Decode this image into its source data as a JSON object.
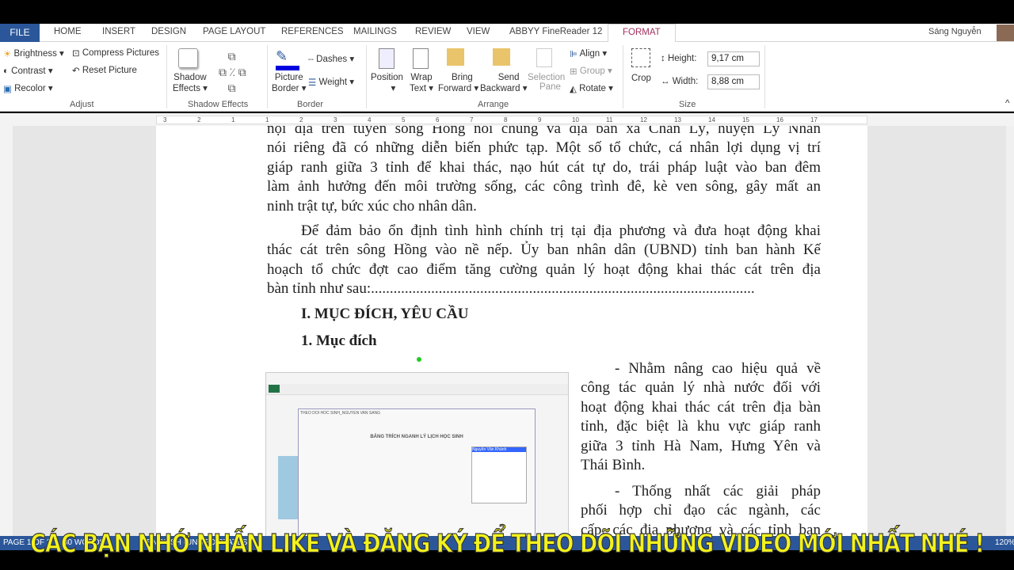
{
  "tabs": {
    "file": "FILE",
    "items": [
      "HOME",
      "INSERT",
      "DESIGN",
      "PAGE LAYOUT",
      "REFERENCES",
      "MAILINGS",
      "REVIEW",
      "VIEW",
      "ABBYY FineReader 12"
    ],
    "format": "FORMAT",
    "user": "Sáng Nguyễn"
  },
  "ribbon": {
    "adjust": {
      "brightness": "Brightness",
      "contrast": "Contrast",
      "recolor": "Recolor",
      "compress": "Compress Pictures",
      "reset": "Reset Picture",
      "label": "Adjust"
    },
    "shadow": {
      "button1": "Shadow",
      "button2": "Effects",
      "label": "Shadow Effects"
    },
    "border": {
      "picture1": "Picture",
      "picture2": "Border",
      "dashes": "Dashes",
      "weight": "Weight",
      "label": "Border"
    },
    "arrange": {
      "position": "Position",
      "wrap1": "Wrap",
      "wrap2": "Text",
      "bring1": "Bring",
      "bring2": "Forward",
      "send1": "Send",
      "send2": "Backward",
      "sel1": "Selection",
      "sel2": "Pane",
      "align": "Align",
      "group": "Group",
      "rotate": "Rotate",
      "label": "Arrange"
    },
    "size": {
      "crop": "Crop",
      "height_label": "Height:",
      "height": "9,17 cm",
      "width_label": "Width:",
      "width": "8,88 cm",
      "label": "Size"
    }
  },
  "ruler": [
    "3",
    "2",
    "1",
    "1",
    "2",
    "3",
    "4",
    "5",
    "6",
    "7",
    "8",
    "9",
    "10",
    "11",
    "12",
    "13",
    "14",
    "15",
    "16",
    "17"
  ],
  "document": {
    "p1_lines": [
      "nội địa trên tuyến sông Hồng nói chung và địa bàn xã Chân Lý, huyện Lý Nhân",
      "nói riêng đã có những diễn biến phức tạp. Một số tổ chức, cá nhân lợi dụng vị trí",
      "giáp ranh giữa 3 tỉnh để khai thác, nạo hút cát tự do, trái pháp luật vào ban đêm",
      "làm ảnh hưởng đến môi trường sống, các công trình đê, kè ven sông, gây mất an",
      "ninh trật tự, bức xúc cho nhân dân."
    ],
    "p2_lines": [
      "Để đảm bảo ổn định tình hình chính trị tại địa phương và đưa hoạt động khai",
      "thác cát trên sông Hồng vào nề nếp. Ủy ban nhân dân (UBND) tỉnh ban hành Kế",
      "hoạch tổ chức đợt cao điểm tăng cường quản lý hoạt động khai thác cát trên địa",
      "bàn tỉnh như sau:......................................................................................................"
    ],
    "heading1": "I. MỤC ĐÍCH, YÊU CẦU",
    "heading2": "1. Mục đích",
    "p3_lines": [
      "- Nhằm nâng cao hiệu quả về",
      "công tác quản lý nhà nước đối với",
      "hoạt động khai thác cát trên địa bàn",
      "tỉnh, đặc biệt là khu vực giáp ranh",
      "giữa 3 tỉnh Hà Nam, Hưng Yên và",
      "Thái Bình."
    ],
    "p4_lines": [
      "- Thống nhất các giải pháp",
      "phối hợp chỉ đạo các ngành, các",
      "cấp, các địa phương và các tỉnh bạn"
    ],
    "image": {
      "form_title": "BẢNG TRÍCH NGANH LÝ LỊCH HỌC SINH",
      "window_title": "THEO DOI HOC SINH_NGUYEN VAN SANG",
      "selected_item": "Nguyễn Văn Khánh"
    }
  },
  "status": {
    "page": "PAGE 1 OF 2",
    "words": "80 WORDS",
    "language": "ENGLISH (UNITED STATES)",
    "zoom": "120%"
  },
  "overlay": "CÁC BẠN NHỚ NHẤN LIKE VÀ ĐĂNG KÝ ĐỂ THEO DÕI NHỮNG VIDEO MỚI NHẤT NHÉ !",
  "colors": {
    "accent": "#2b579a",
    "format_tab": "#a1315f",
    "overlay": "#f2f21e"
  }
}
